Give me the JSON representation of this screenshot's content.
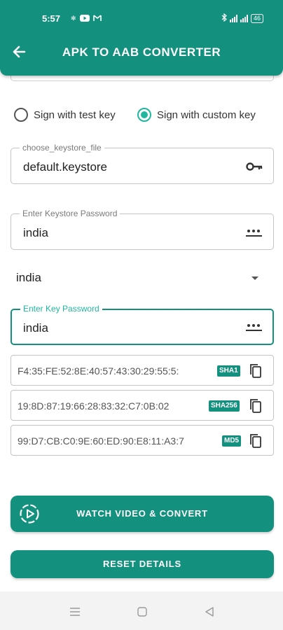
{
  "status_bar": {
    "time": "5:57",
    "battery": "46"
  },
  "header": {
    "title": "APK TO AAB CONVERTER"
  },
  "signing": {
    "test_key_label": "Sign with test key",
    "custom_key_label": "Sign with custom key",
    "selected": "custom"
  },
  "keystore_file": {
    "label": "choose_keystore_file",
    "value": "default.keystore"
  },
  "keystore_password": {
    "label": "Enter Keystore Password",
    "value": "india"
  },
  "alias": {
    "selected": "india"
  },
  "key_password": {
    "label": "Enter Key Password",
    "value": "india"
  },
  "fingerprints": [
    {
      "value": "F4:35:FE:52:8E:40:57:43:30:29:55:5:",
      "type": "SHA1"
    },
    {
      "value": "19:8D:87:19:66:28:83:32:C7:0B:02",
      "type": "SHA256"
    },
    {
      "value": "99:D7:CB:C0:9E:60:ED:90:E8:11:A3:7",
      "type": "MD5"
    }
  ],
  "buttons": {
    "watch_convert": "WATCH VIDEO & CONVERT",
    "reset": "RESET DETAILS"
  },
  "colors": {
    "primary": "#14917e",
    "accent": "#1fb89f"
  }
}
